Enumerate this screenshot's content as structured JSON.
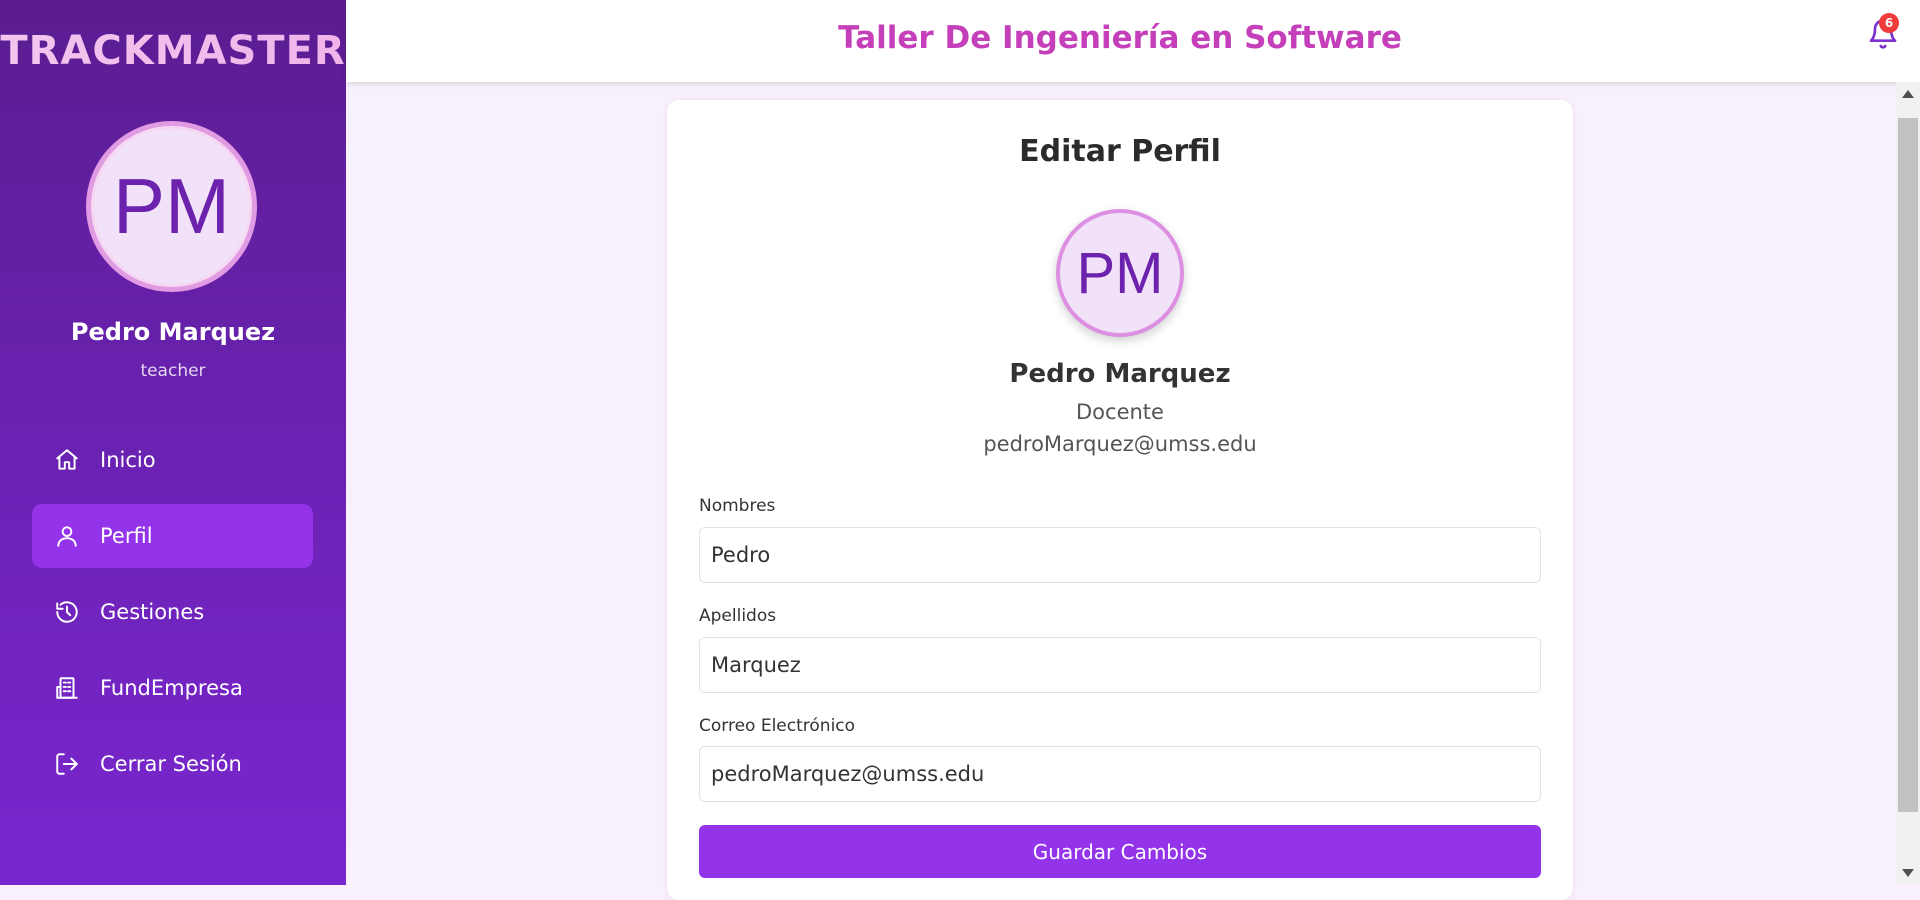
{
  "sidebar": {
    "brand": "TRACKMASTER",
    "avatar_initials": "PM",
    "user_name": "Pedro Marquez",
    "user_role": "teacher",
    "items": [
      {
        "label": "Inicio",
        "icon": "home-icon",
        "active": false
      },
      {
        "label": "Perfil",
        "icon": "user-icon",
        "active": true
      },
      {
        "label": "Gestiones",
        "icon": "history-icon",
        "active": false
      },
      {
        "label": "FundEmpresa",
        "icon": "building-icon",
        "active": false
      },
      {
        "label": "Cerrar Sesión",
        "icon": "logout-icon",
        "active": false
      }
    ]
  },
  "header": {
    "title": "Taller De Ingeniería en Software",
    "notification_count": "6",
    "title_color": "#c43fb9"
  },
  "profile": {
    "title": "Editar Perfil",
    "avatar_initials": "PM",
    "name": "Pedro Marquez",
    "role": "Docente",
    "email": "pedroMarquez@umss.edu"
  },
  "form": {
    "nombres_label": "Nombres",
    "nombres_value": "Pedro",
    "apellidos_label": "Apellidos",
    "apellidos_value": "Marquez",
    "correo_label": "Correo Electrónico",
    "correo_value": "pedroMarquez@umss.edu",
    "save_label": "Guardar Cambios"
  },
  "colors": {
    "accent": "#9333ea",
    "sidebar_bg": "#6a22b2",
    "badge": "#ef3b3b"
  }
}
